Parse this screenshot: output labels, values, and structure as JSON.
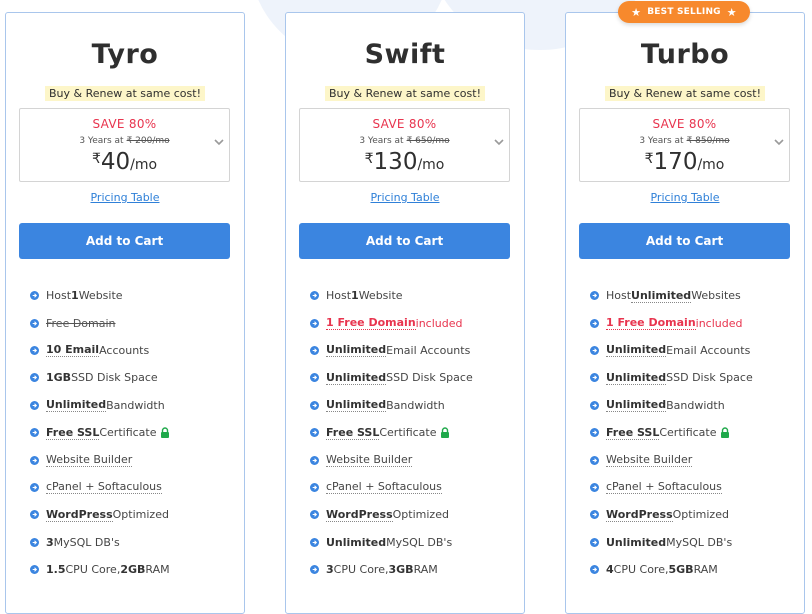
{
  "badge": {
    "label": "BEST SELLING"
  },
  "plans": [
    {
      "name": "Tyro",
      "tagline": "Buy & Renew at same cost!",
      "save": "SAVE 80%",
      "term": "3 Years at",
      "old_price": "₹ 200/mo",
      "currency": "₹",
      "price": "40",
      "per": "/mo",
      "pricing_link": "Pricing Table",
      "cart_label": "Add to Cart",
      "features": {
        "host": {
          "pre": "Host ",
          "bold": "1",
          "post": " Website"
        },
        "domain": {
          "text": "Free Domain"
        },
        "email": {
          "bold": "10 Email",
          "post": " Accounts"
        },
        "disk": {
          "bold": "1GB",
          "post": " SSD Disk Space"
        },
        "bandwidth": {
          "bold": "Unlimited",
          "post": " Bandwidth"
        },
        "ssl": {
          "bold": "Free SSL",
          "post": " Certificate"
        },
        "builder": {
          "text": "Website Builder"
        },
        "cpanel": {
          "text": "cPanel + Softaculous"
        },
        "wordpress": {
          "bold": "WordPress",
          "post": " Optimized"
        },
        "mysql": {
          "bold": "3",
          "post": " MySQL DB's"
        },
        "cpu": {
          "bold": "1.5",
          "mid": " CPU Core, ",
          "bold2": "2GB",
          "post": " RAM"
        }
      }
    },
    {
      "name": "Swift",
      "tagline": "Buy & Renew at same cost!",
      "save": "SAVE 80%",
      "term": "3 Years at",
      "old_price": "₹ 650/mo",
      "currency": "₹",
      "price": "130",
      "per": "/mo",
      "pricing_link": "Pricing Table",
      "cart_label": "Add to Cart",
      "features": {
        "host": {
          "pre": "Host ",
          "bold": "1",
          "post": " Website"
        },
        "domain": {
          "bold": "1 Free Domain",
          "post": " included"
        },
        "email": {
          "bold": "Unlimited",
          "post": " Email Accounts"
        },
        "disk": {
          "bold": "Unlimited",
          "post": " SSD Disk Space"
        },
        "bandwidth": {
          "bold": "Unlimited",
          "post": " Bandwidth"
        },
        "ssl": {
          "bold": "Free SSL",
          "post": " Certificate"
        },
        "builder": {
          "text": "Website Builder"
        },
        "cpanel": {
          "text": "cPanel + Softaculous"
        },
        "wordpress": {
          "bold": "WordPress",
          "post": " Optimized"
        },
        "mysql": {
          "bold": "Unlimited",
          "post": " MySQL DB's"
        },
        "cpu": {
          "bold": "3",
          "mid": " CPU Core, ",
          "bold2": "3GB",
          "post": " RAM"
        }
      }
    },
    {
      "name": "Turbo",
      "tagline": "Buy & Renew at same cost!",
      "save": "SAVE 80%",
      "term": "3 Years at",
      "old_price": "₹ 850/mo",
      "currency": "₹",
      "price": "170",
      "per": "/mo",
      "pricing_link": "Pricing Table",
      "cart_label": "Add to Cart",
      "features": {
        "host": {
          "pre": "Host ",
          "bold": "Unlimited",
          "post": " Websites"
        },
        "domain": {
          "bold": "1 Free Domain",
          "post": " included"
        },
        "email": {
          "bold": "Unlimited",
          "post": " Email Accounts"
        },
        "disk": {
          "bold": "Unlimited",
          "post": " SSD Disk Space"
        },
        "bandwidth": {
          "bold": "Unlimited",
          "post": " Bandwidth"
        },
        "ssl": {
          "bold": "Free SSL",
          "post": " Certificate"
        },
        "builder": {
          "text": "Website Builder"
        },
        "cpanel": {
          "text": "cPanel + Softaculous"
        },
        "wordpress": {
          "bold": "WordPress",
          "post": " Optimized"
        },
        "mysql": {
          "bold": "Unlimited",
          "post": " MySQL DB's"
        },
        "cpu": {
          "bold": "4",
          "mid": " CPU Core, ",
          "bold2": "5GB",
          "post": " RAM"
        }
      }
    }
  ],
  "colors": {
    "accent": "#3b85e0",
    "save_red": "#e8344e",
    "badge_orange": "#f7892d",
    "bullet_blue": "#3b85e0",
    "lock_green": "#1fa94a",
    "card_border": "#a9c6ec"
  },
  "icons": {
    "bullet": "arrow-circle-right-icon",
    "lock": "lock-icon",
    "chevron": "chevron-down-icon",
    "star": "star-icon"
  }
}
